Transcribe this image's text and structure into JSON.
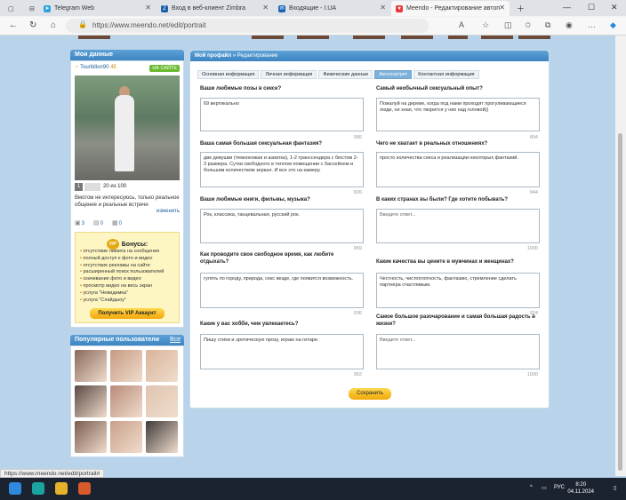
{
  "browser": {
    "tabs": [
      {
        "label": "Telegram Web",
        "icon": "telegram-icon",
        "color": "#2aa3e0",
        "active": false
      },
      {
        "label": "Вход в веб-клиент Zimbra",
        "icon": "zimbra-icon",
        "color": "#1d5fa8",
        "active": false
      },
      {
        "label": "Входящие - I.UA",
        "icon": "mail-icon",
        "color": "#1c62b9",
        "active": false
      },
      {
        "label": "Meendo - Редактирование автоп",
        "icon": "heart-icon",
        "color": "#e8393d",
        "active": true
      }
    ],
    "url": "https://www.meendo.net/edit/portrait",
    "status_url": "https://www.meendo.net/edit/portrait#"
  },
  "sidebar": {
    "title": "Мои данные",
    "username": "Tourbillon90",
    "age": "45",
    "online": "НА САЙТЕ",
    "photo_index": "1",
    "photo_count": "20 из 100",
    "motto": "Вмотом не интересуюсь, только реальное общение и реальные встречи",
    "change": "изменить",
    "stats": [
      "3",
      "0",
      "0"
    ],
    "vip": {
      "badge": "VIP",
      "title": "Бонусы:",
      "items": [
        "отсутствие лимита на сообщения",
        "полный доступ к фото и видео",
        "отсутствие рекламы на сайте",
        "расширенный поиск пользователей",
        "скачивание фото и видео",
        "просмотр видео на весь экран",
        "услуга \"Невидимка\"",
        "услуга \"Слайдшоу\""
      ],
      "button": "Получить VIP Аккаунт"
    },
    "popular": {
      "title": "Популярные пользователи",
      "all": "Все",
      "colors": [
        "#8a6a5a",
        "#c69a82",
        "#d8b49a",
        "#5a4a44",
        "#b98b7a",
        "#e0c4b0",
        "#7a5c50",
        "#c9a089",
        "#3e3a3a"
      ]
    }
  },
  "main": {
    "breadcrumb_root": "Мой профайл",
    "breadcrumb_sep": "»",
    "breadcrumb_current": "Редактирование",
    "tabs": [
      "Основная информация",
      "Личная информация",
      "Физические данные",
      "Автопортрет",
      "Контактная информация"
    ],
    "active_tab": 3,
    "questions": [
      {
        "label": "Ваши любимые позы в сексе?",
        "value": "69 вертикально",
        "count": "986"
      },
      {
        "label": "Самый необычный сексуальный опыт?",
        "value": "Пожалуй на дереве, когда под нами проходят прогуливающиеся люди, не зная, что творится у них над головой))",
        "count": "894"
      },
      {
        "label": "Ваша самая большая сексуальная фантазия?",
        "value": "две девушки (темнокожая и азиатка), 1-2 транссендера с бюстом 2-3 размера. Сутки свободного в теплом помещении с бассейном и большим количеством зеркал. И все это на камеру.",
        "count": "826"
      },
      {
        "label": "Чего не хватает в реальных отношениях?",
        "value": "просто количества секса и реализации некоторых фантазий.",
        "count": "944"
      },
      {
        "label": "Ваши любимые книги, фильмы, музыка?",
        "value": "Рок, классика, танцевальная, русский рок.",
        "count": "959"
      },
      {
        "label": "В каких странах вы были? Где хотите побывать?",
        "value": "Введите ответ...",
        "count": "1000"
      },
      {
        "label": "Как проводите свое свободное время, как любите отдыхать?",
        "value": "гулять по городу, природа, секс везде, где появится возможность.",
        "count": "936"
      },
      {
        "label": "Какие качества вы цените в мужчинах и женщинах?",
        "value": "Честность, чистоплотность, фантазию, стремление сделать партнера счастливым.",
        "count": "924"
      },
      {
        "label": "Какие у вас хобби, чем увлекаетесь?",
        "value": "Пишу стихи и эротическую прозу, играю на гитаре.",
        "count": "952"
      },
      {
        "label": "Самое большое разочарование и самая большая радость в жизни?",
        "value": "Введите ответ...",
        "count": "1000"
      }
    ],
    "save": "Сохранить"
  },
  "taskbar": {
    "lang": "РУС",
    "time": "8:20",
    "date": "04.11.2024"
  }
}
